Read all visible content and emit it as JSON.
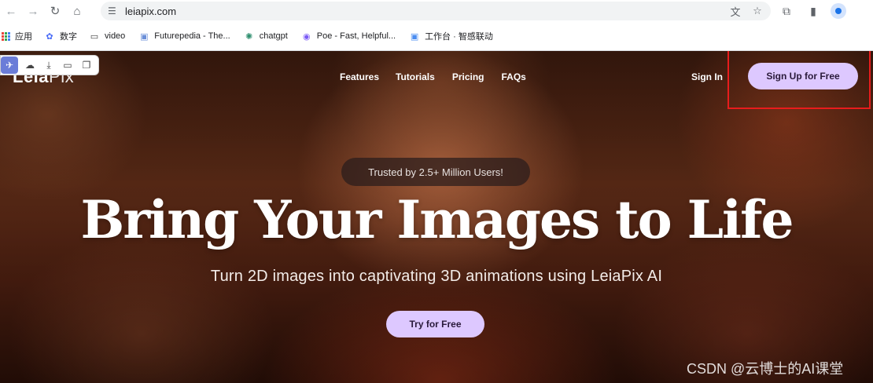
{
  "browser": {
    "url": "leiapix.com",
    "bookmarks": [
      {
        "label": "应用",
        "icon": "apps-grid-icon"
      },
      {
        "label": "数字",
        "icon": "gear-icon"
      },
      {
        "label": "video",
        "icon": "folder-icon"
      },
      {
        "label": "Futurepedia - The...",
        "icon": "page-icon"
      },
      {
        "label": "chatgpt",
        "icon": "openai-icon"
      },
      {
        "label": "Poe - Fast, Helpful...",
        "icon": "poe-icon"
      },
      {
        "label": "工作台 · 智感联动",
        "icon": "app-icon"
      }
    ]
  },
  "site": {
    "logo_main": "Leia",
    "logo_sub": "Pix",
    "nav": [
      "Features",
      "Tutorials",
      "Pricing",
      "FAQs"
    ],
    "sign_in": "Sign In",
    "sign_up": "Sign Up for Free"
  },
  "hero": {
    "badge": "Trusted by 2.5+ Million Users!",
    "headline": "Bring Your Images to Life",
    "subheadline": "Turn 2D images into captivating 3D animations using LeiaPix AI",
    "cta": "Try for Free"
  },
  "watermark": "CSDN @云博士的AI课堂",
  "colors": {
    "button_bg": "#ddc8ff",
    "highlight": "#e81c1c"
  }
}
